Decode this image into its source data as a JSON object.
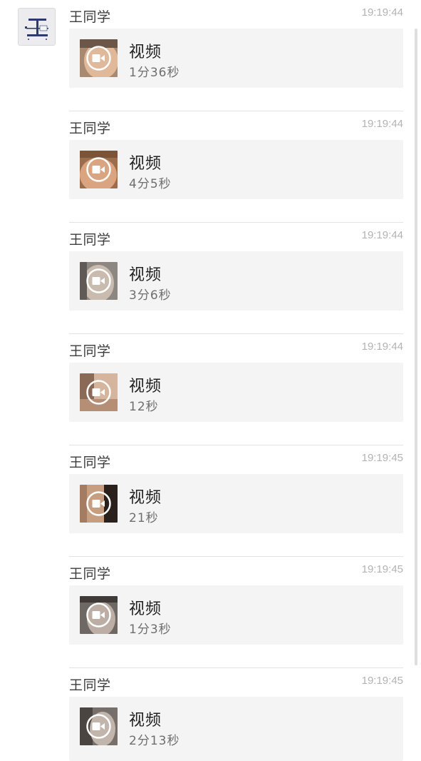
{
  "chat": {
    "sender_avatar_icon": "wang-avatar-icon",
    "video_icon": "video-camera-icon",
    "messages": [
      {
        "sender": "王同学",
        "time": "19:19:44",
        "title": "视频",
        "duration": "1分36秒"
      },
      {
        "sender": "王同学",
        "time": "19:19:44",
        "title": "视频",
        "duration": "4分5秒"
      },
      {
        "sender": "王同学",
        "time": "19:19:44",
        "title": "视频",
        "duration": "3分6秒"
      },
      {
        "sender": "王同学",
        "time": "19:19:44",
        "title": "视频",
        "duration": "12秒"
      },
      {
        "sender": "王同学",
        "time": "19:19:45",
        "title": "视频",
        "duration": "21秒"
      },
      {
        "sender": "王同学",
        "time": "19:19:45",
        "title": "视频",
        "duration": "1分3秒"
      },
      {
        "sender": "王同学",
        "time": "19:19:45",
        "title": "视频",
        "duration": "2分13秒"
      }
    ]
  },
  "colors": {
    "background": "#ffffff",
    "card_background": "#f4f4f4",
    "timestamp": "#b3b3b3",
    "divider": "#e3e3e3",
    "scrollbar": "#dedede"
  }
}
